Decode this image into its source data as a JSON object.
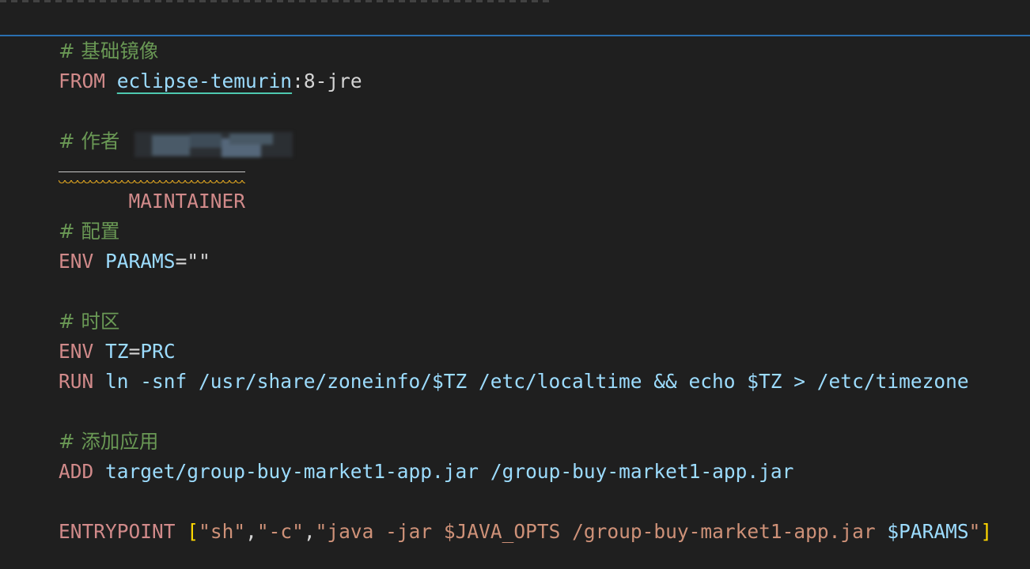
{
  "editor": {
    "lines": [
      {
        "comment": "# 基础镜像"
      },
      {
        "keyword": "FROM",
        "image_name": "eclipse-temurin",
        "image_tag": ":8-jre"
      },
      {
        "comment": "# 作者"
      },
      {
        "keyword": "MAINTAINER"
      },
      {
        "comment": "# 配置"
      },
      {
        "keyword": "ENV",
        "var": "PARAMS",
        "op": "=",
        "value": "\"\""
      },
      {
        "comment": "# 时区"
      },
      {
        "keyword": "ENV",
        "var": "TZ",
        "op": "=",
        "value": "PRC"
      },
      {
        "keyword": "RUN",
        "command": "ln -snf /usr/share/zoneinfo/$TZ /etc/localtime && echo $TZ > /etc/timezone"
      },
      {
        "comment": "# 添加应用"
      },
      {
        "keyword": "ADD",
        "src": "target/group-buy-market1-app.jar",
        "dest": "/group-buy-market1-app.jar"
      },
      {
        "keyword": "ENTRYPOINT",
        "open": "[",
        "arg1": "\"sh\"",
        "sep1": ",",
        "arg2": "\"-c\"",
        "sep2": ",",
        "arg3_pre": "\"java -jar $JAVA_OPTS /group-buy-market1-app.jar ",
        "arg3_var": "$PARAMS",
        "arg3_post": "\"",
        "close": "]"
      }
    ]
  },
  "colors": {
    "background": "#1f1f1f",
    "comment": "#6a9955",
    "keyword": "#d18a8a",
    "variable": "#9cdcfe",
    "string": "#ce9178",
    "bracket": "#ffd700",
    "current_line_border": "#2a6fb0"
  }
}
